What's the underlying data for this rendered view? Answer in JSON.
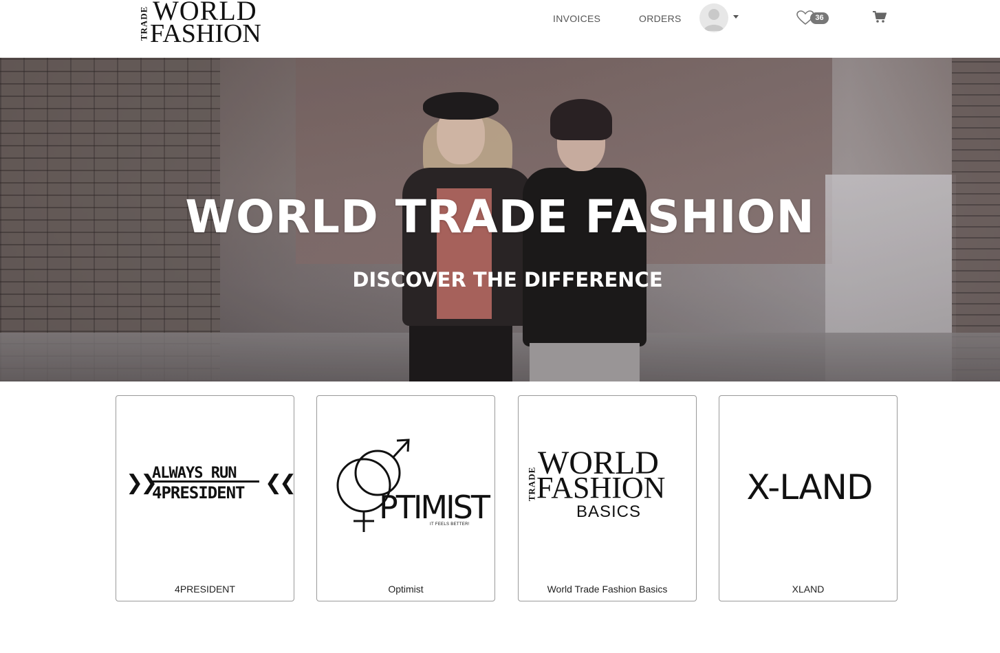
{
  "header": {
    "logo_trade": "TRADE",
    "logo_line1": "WORLD",
    "logo_line2": "FASHION",
    "nav": {
      "invoices": "INVOICES",
      "orders": "ORDERS"
    },
    "wishlist_count": "36"
  },
  "hero": {
    "title": "WORLD TRADE FASHION",
    "subtitle": "DISCOVER THE DIFFERENCE"
  },
  "brands": [
    {
      "name": "4PRESIDENT",
      "logo_line1": "ALWAYS RUN",
      "logo_line2": "4PRESIDENT"
    },
    {
      "name": "Optimist",
      "logo_text": "PTIMIST",
      "logo_tagline": "IT FEELS BETTER!"
    },
    {
      "name": "World Trade Fashion Basics",
      "logo_trade": "TRADE",
      "logo_line1": "WORLD",
      "logo_line2": "FASHION",
      "logo_line3": "BASICS"
    },
    {
      "name": "XLAND",
      "logo_text": "X-LAND"
    }
  ],
  "icons": {
    "avatar": "user-avatar-icon",
    "caret": "caret-down-icon",
    "wishlist": "heart-icon",
    "cart": "shopping-cart-icon"
  }
}
